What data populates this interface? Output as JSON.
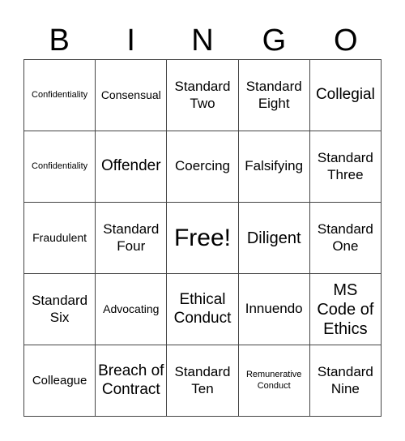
{
  "header": {
    "letters": [
      "B",
      "I",
      "N",
      "G",
      "O"
    ]
  },
  "board": {
    "rows": [
      [
        "Confidentiality",
        "Consensual",
        "Standard Two",
        "Standard Eight",
        "Collegial"
      ],
      [
        "Confidentiality",
        "Offender",
        "Coercing",
        "Falsifying",
        "Standard Three"
      ],
      [
        "Fraudulent",
        "Standard Four",
        "Free!",
        "Diligent",
        "Standard One"
      ],
      [
        "Standard Six",
        "Advocating",
        "Ethical Conduct",
        "Innuendo",
        "MS Code of Ethics"
      ],
      [
        "Colleague",
        "Breach of Contract",
        "Standard Ten",
        "Remunerative Conduct",
        "Standard Nine"
      ]
    ]
  }
}
